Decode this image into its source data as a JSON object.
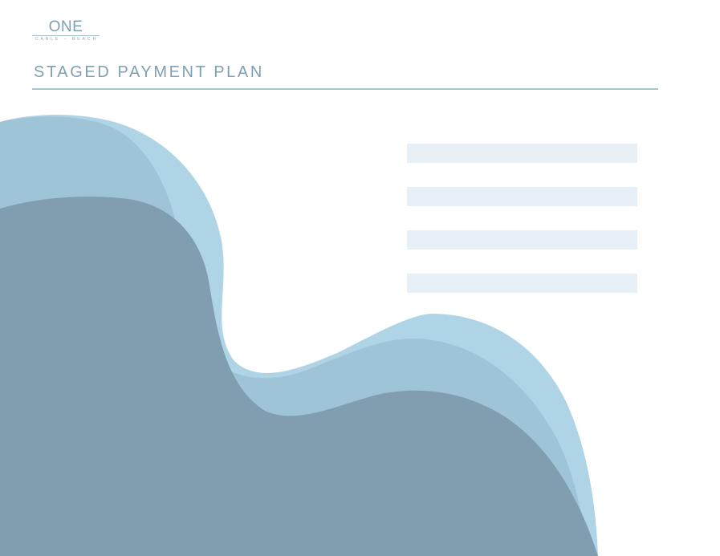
{
  "logo": {
    "main": "ONE",
    "sub": "CABLE – BEACH"
  },
  "title": "STAGED PAYMENT PLAN",
  "colors": {
    "accent": "#7f9fb3",
    "rule": "#a9c4cf",
    "bar_fill": "#e7f0f7",
    "wave_light": "#aed4e6",
    "wave_mid": "#9fc4d7",
    "wave_dark": "#809eaf"
  },
  "info_bars": [
    {
      "text": ""
    },
    {
      "text": ""
    },
    {
      "text": ""
    },
    {
      "text": ""
    }
  ]
}
